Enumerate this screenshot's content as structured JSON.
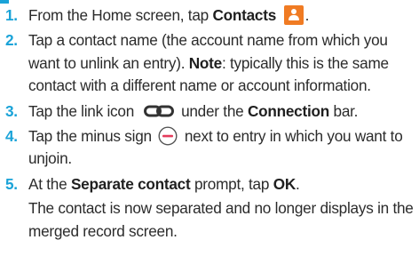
{
  "colors": {
    "accent": "#1aa3d8",
    "contacts_icon": "#f07b23",
    "minus_icon": "#e43c5c"
  },
  "steps": [
    {
      "number": "1.",
      "t1": "From the Home screen, tap ",
      "b1": "Contacts",
      "icon": "contacts-app-icon",
      "t2": "."
    },
    {
      "number": "2.",
      "t1": "Tap a contact name (the account name from which you want to unlink an entry). ",
      "b1": "Note",
      "t2": ": typically this is the same contact with a different name or account information."
    },
    {
      "number": "3.",
      "t1": "Tap the link icon",
      "icon": "link-icon",
      "t2": "under the ",
      "b1": "Connection",
      "t3": " bar."
    },
    {
      "number": "4.",
      "t1": "Tap the minus sign",
      "icon": "minus-circle-icon",
      "t2": "next to entry in which you want to unjoin."
    },
    {
      "number": "5.",
      "t1": "At the ",
      "b1": "Separate contact",
      "t2": " prompt, tap ",
      "b2": "OK",
      "t3": ".",
      "note": "The contact is now separated and no longer displays in the merged record screen."
    }
  ]
}
